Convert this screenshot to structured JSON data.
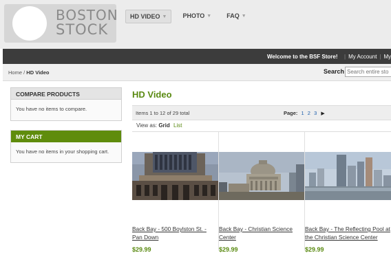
{
  "logo": {
    "line1": "BOSTON",
    "line2": "STOCK"
  },
  "topnav": [
    {
      "label": "HD VIDEO",
      "active": true
    },
    {
      "label": "PHOTO",
      "active": false
    },
    {
      "label": "FAQ",
      "active": false
    }
  ],
  "topbar": {
    "welcome": "Welcome to the BSF Store!",
    "my_account": "My Account",
    "my_wishlist": "My Wis"
  },
  "breadcrumb": {
    "home": "Home",
    "separator": " / ",
    "current": "HD Video"
  },
  "search": {
    "label": "Search",
    "placeholder": "Search entire sto"
  },
  "sidebar": {
    "compare": {
      "title": "COMPARE PRODUCTS",
      "text": "You have no items to compare."
    },
    "cart": {
      "title": "MY CART",
      "text": "You have no items in your shopping cart."
    }
  },
  "main": {
    "title": "HD Video",
    "toolbar": {
      "amount": "Items 1 to 12 of 29 total",
      "page_label": "Page:",
      "pages": [
        "1",
        "2",
        "3"
      ],
      "current_page": "1",
      "next": "▶"
    },
    "view": {
      "label": "View as:",
      "grid": "Grid",
      "list": "List"
    },
    "products": [
      {
        "name": "Back Bay - 500 Boylston St. - Pan Down",
        "price": "$29.99"
      },
      {
        "name": "Back Bay - Christian Science Center",
        "price": "$29.99"
      },
      {
        "name": "Back Bay - The Reflecting Pool at the Christian Science Center",
        "price": "$29.99"
      }
    ]
  },
  "colors": {
    "accent": "#5a8a12",
    "cart_header": "#5f8c0c",
    "topbar": "#3c3c3c",
    "link": "#1a5cab"
  }
}
